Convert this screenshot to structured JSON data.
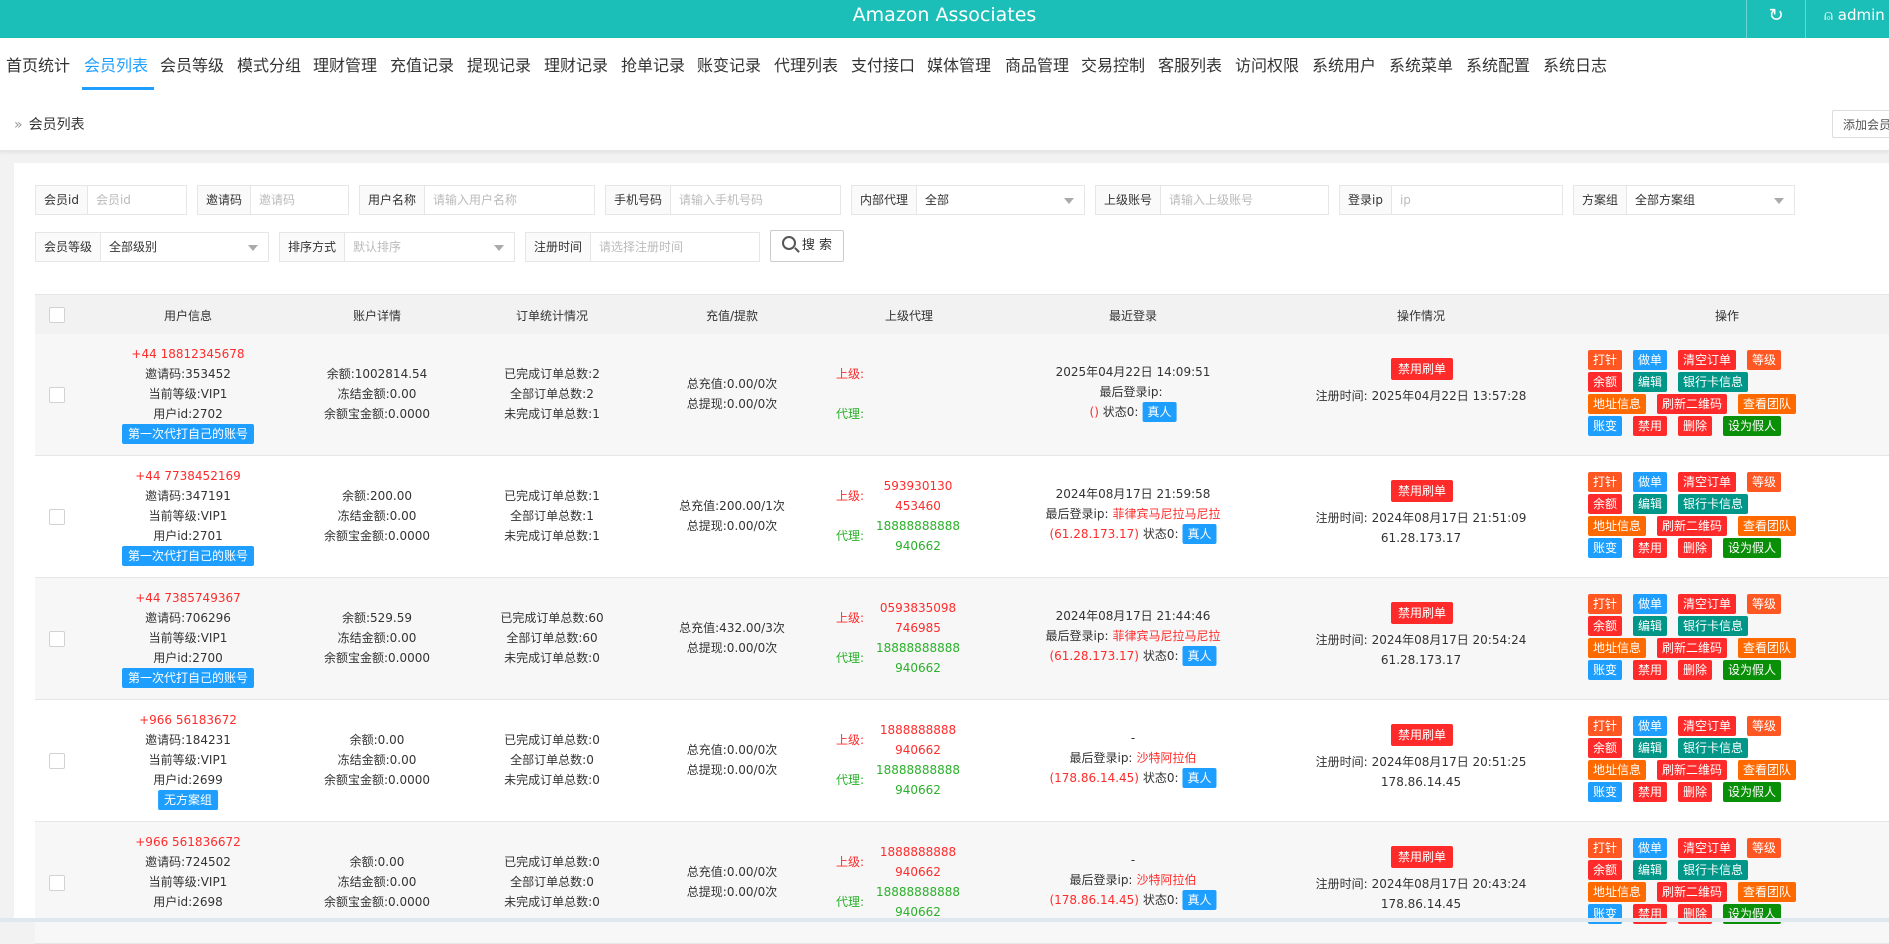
{
  "header": {
    "title": "Amazon Associates",
    "refresh_icon": "↻",
    "user": "admin"
  },
  "nav": [
    {
      "label": "首页统计"
    },
    {
      "label": "会员列表",
      "active": true
    },
    {
      "label": "会员等级"
    },
    {
      "label": "模式分组"
    },
    {
      "label": "理财管理"
    },
    {
      "label": "充值记录"
    },
    {
      "label": "提现记录"
    },
    {
      "label": "理财记录"
    },
    {
      "label": "抢单记录"
    },
    {
      "label": "账变记录"
    },
    {
      "label": "代理列表"
    },
    {
      "label": "支付接口"
    },
    {
      "label": "媒体管理"
    },
    {
      "label": "商品管理"
    },
    {
      "label": "交易控制"
    },
    {
      "label": "客服列表"
    },
    {
      "label": "访问权限"
    },
    {
      "label": "系统用户"
    },
    {
      "label": "系统菜单"
    },
    {
      "label": "系统配置"
    },
    {
      "label": "系统日志"
    }
  ],
  "breadcrumb": {
    "current": "会员列表",
    "add_button": "添加会员"
  },
  "filters": {
    "member_id": {
      "label": "会员id",
      "placeholder": "会员id"
    },
    "invite_code": {
      "label": "邀请码",
      "placeholder": "邀请码"
    },
    "username": {
      "label": "用户名称",
      "placeholder": "请输入用户名称"
    },
    "phone": {
      "label": "手机号码",
      "placeholder": "请输入手机号码"
    },
    "internal_agent": {
      "label": "内部代理",
      "value": "全部"
    },
    "parent_account": {
      "label": "上级账号",
      "placeholder": "请输入上级账号"
    },
    "login_ip": {
      "label": "登录ip",
      "placeholder": "ip"
    },
    "plan_group": {
      "label": "方案组",
      "value": "全部方案组"
    },
    "member_level": {
      "label": "会员等级",
      "value": "全部级别"
    },
    "sort": {
      "label": "排序方式",
      "value": "默认排序"
    },
    "register_time": {
      "label": "注册时间",
      "placeholder": "请选择注册时间"
    },
    "search_button": "搜 索"
  },
  "table": {
    "headers": {
      "user_info": "用户信息",
      "account": "账户详情",
      "orders": "订单统计情况",
      "recharge": "充值/提款",
      "agent": "上级代理",
      "login": "最近登录",
      "ops_status": "操作情况",
      "actions": "操作"
    },
    "labels": {
      "parent": "上级:",
      "agent": "代理:",
      "last_login_ip": "最后登录ip:",
      "status": "状态0:",
      "real": "真人",
      "ban": "禁用刷单",
      "register_time": "注册时间:"
    },
    "actions": {
      "row1": [
        "打针",
        "做单",
        "清空订单",
        "等级"
      ],
      "row2": [
        "余额",
        "编辑",
        "银行卡信息"
      ],
      "row3": [
        "地址信息",
        "刷新二维码",
        "查看团队"
      ],
      "row4": [
        "账变",
        "禁用",
        "删除",
        "设为假人"
      ]
    },
    "rows": [
      {
        "phone": "+44   18812345678",
        "invite": "邀请码:353452",
        "level": "当前等级:VIP1",
        "uid": "用户id:2702",
        "tag": "第一次代打自己的账号",
        "balance": "余额:1002814.54",
        "frozen": "冻结金额:0.00",
        "yuebao": "余额宝金额:0.0000",
        "done": "已完成订单总数:2",
        "all": "全部订单总数:2",
        "undone": "未完成订单总数:1",
        "recharge": "总充值:0.00/0次",
        "withdraw": "总提现:0.00/0次",
        "parent_a": "",
        "parent_b": "",
        "agent_a": "",
        "agent_b": "",
        "login_time": "2025年04月22日 14:09:51",
        "login_loc": "",
        "login_ip": "()",
        "reg_time": "2025年04月22日 13:57:28",
        "reg_ip": ""
      },
      {
        "phone": "+44   7738452169",
        "invite": "邀请码:347191",
        "level": "当前等级:VIP1",
        "uid": "用户id:2701",
        "tag": "第一次代打自己的账号",
        "balance": "余额:200.00",
        "frozen": "冻结金额:0.00",
        "yuebao": "余额宝金额:0.0000",
        "done": "已完成订单总数:1",
        "all": "全部订单总数:1",
        "undone": "未完成订单总数:1",
        "recharge": "总充值:200.00/1次",
        "withdraw": "总提现:0.00/0次",
        "parent_a": "593930130",
        "parent_b": "453460",
        "agent_a": "18888888888",
        "agent_b": "940662",
        "login_time": "2024年08月17日 21:59:58",
        "login_loc": "菲律宾马尼拉马尼拉",
        "login_ip": "(61.28.173.17)",
        "reg_time": "2024年08月17日 21:51:09",
        "reg_ip": "61.28.173.17"
      },
      {
        "phone": "+44   7385749367",
        "invite": "邀请码:706296",
        "level": "当前等级:VIP1",
        "uid": "用户id:2700",
        "tag": "第一次代打自己的账号",
        "balance": "余额:529.59",
        "frozen": "冻结金额:0.00",
        "yuebao": "余额宝金额:0.0000",
        "done": "已完成订单总数:60",
        "all": "全部订单总数:60",
        "undone": "未完成订单总数:0",
        "recharge": "总充值:432.00/3次",
        "withdraw": "总提现:0.00/0次",
        "parent_a": "0593835098",
        "parent_b": "746985",
        "agent_a": "18888888888",
        "agent_b": "940662",
        "login_time": "2024年08月17日 21:44:46",
        "login_loc": "菲律宾马尼拉马尼拉",
        "login_ip": "(61.28.173.17)",
        "reg_time": "2024年08月17日 20:54:24",
        "reg_ip": "61.28.173.17"
      },
      {
        "phone": "+966   56183672",
        "invite": "邀请码:184231",
        "level": "当前等级:VIP1",
        "uid": "用户id:2699",
        "tag": "无方案组",
        "balance": "余额:0.00",
        "frozen": "冻结金额:0.00",
        "yuebao": "余额宝金额:0.0000",
        "done": "已完成订单总数:0",
        "all": "全部订单总数:0",
        "undone": "未完成订单总数:0",
        "recharge": "总充值:0.00/0次",
        "withdraw": "总提现:0.00/0次",
        "parent_a": "1888888888",
        "parent_b": "940662",
        "agent_a": "18888888888",
        "agent_b": "940662",
        "login_time": "-",
        "login_loc": "沙特阿拉伯",
        "login_ip": "(178.86.14.45)",
        "reg_time": "2024年08月17日 20:51:25",
        "reg_ip": "178.86.14.45"
      },
      {
        "phone": "+966   561836672",
        "invite": "邀请码:724502",
        "level": "当前等级:VIP1",
        "uid": "用户id:2698",
        "tag": "",
        "balance": "余额:0.00",
        "frozen": "冻结金额:0.00",
        "yuebao": "余额宝金额:0.0000",
        "done": "已完成订单总数:0",
        "all": "全部订单总数:0",
        "undone": "未完成订单总数:0",
        "recharge": "总充值:0.00/0次",
        "withdraw": "总提现:0.00/0次",
        "parent_a": "1888888888",
        "parent_b": "940662",
        "agent_a": "18888888888",
        "agent_b": "940662",
        "login_time": "-",
        "login_loc": "沙特阿拉伯",
        "login_ip": "(178.86.14.45)",
        "reg_time": "2024年08月17日 20:43:24",
        "reg_ip": "178.86.14.45"
      }
    ]
  }
}
